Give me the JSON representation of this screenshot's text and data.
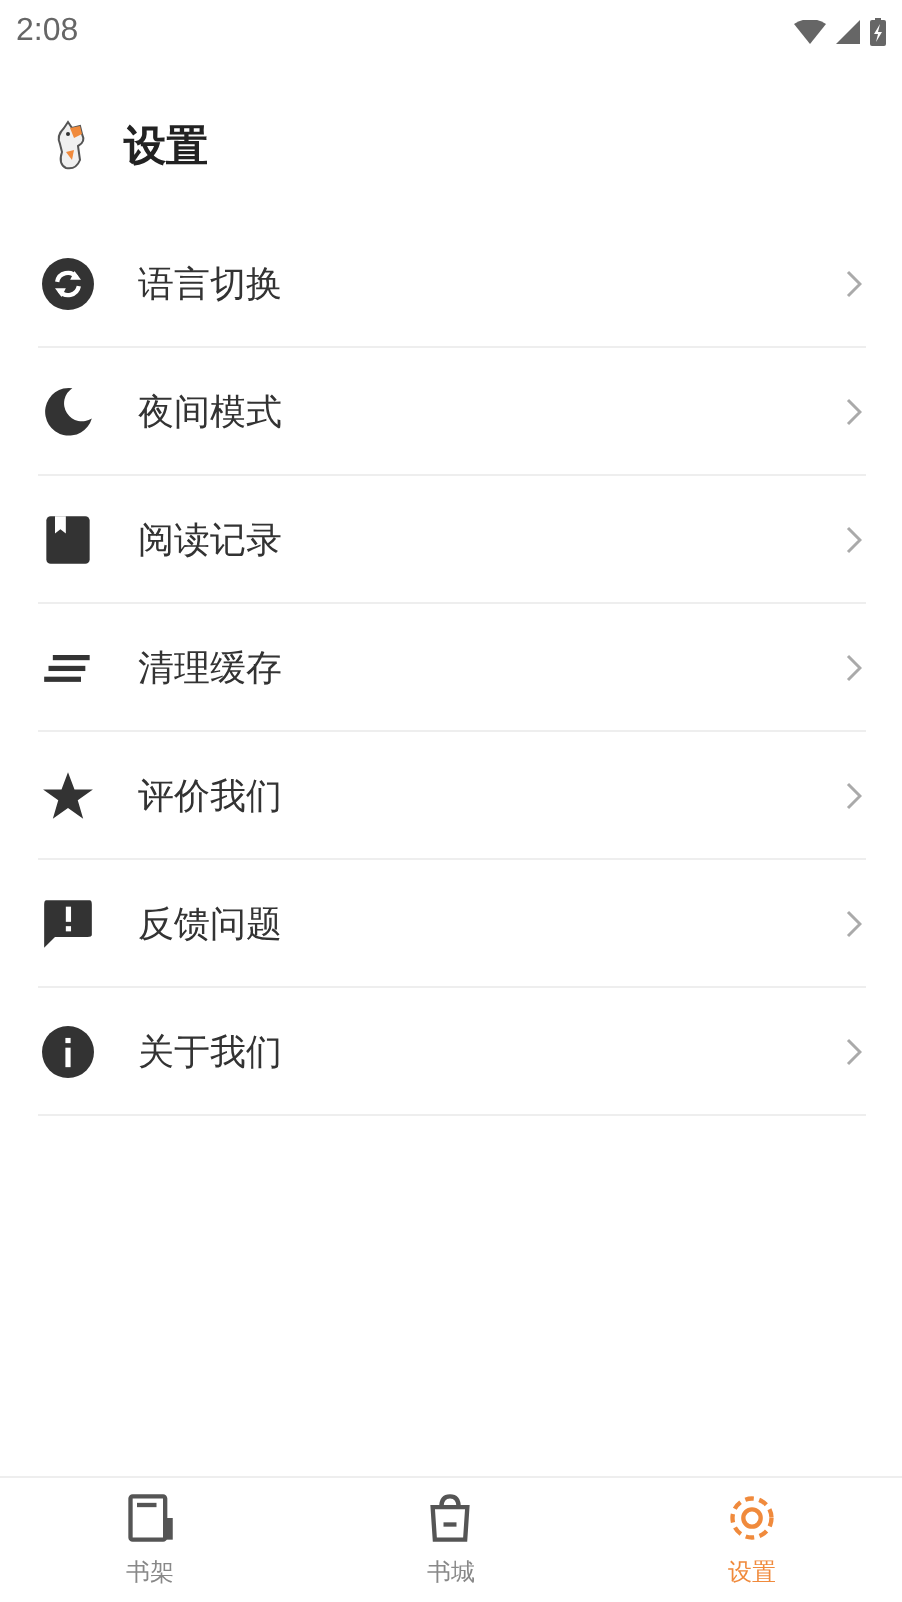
{
  "status_bar": {
    "time": "2:08"
  },
  "header": {
    "title": "设置"
  },
  "settings_items": [
    {
      "label": "语言切换"
    },
    {
      "label": "夜间模式"
    },
    {
      "label": "阅读记录"
    },
    {
      "label": "清理缓存"
    },
    {
      "label": "评价我们"
    },
    {
      "label": "反馈问题"
    },
    {
      "label": "关于我们"
    }
  ],
  "bottom_nav": [
    {
      "label": "书架",
      "selected": false
    },
    {
      "label": "书城",
      "selected": false
    },
    {
      "label": "设置",
      "selected": true
    }
  ]
}
